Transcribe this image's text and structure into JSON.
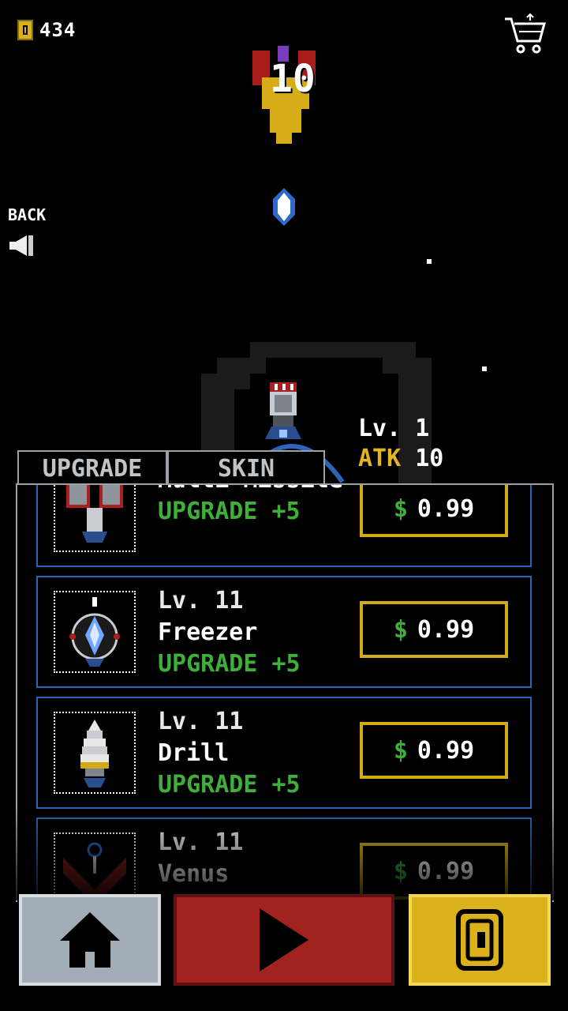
{
  "hud": {
    "coins": "434"
  },
  "back": {
    "label": "BACK"
  },
  "combat": {
    "damage": "10"
  },
  "ship_stats": {
    "level": "Lv. 1",
    "atk_label": "ATK",
    "atk_value": "10"
  },
  "tabs": [
    {
      "label": "UPGRADE"
    },
    {
      "label": "SKIN"
    }
  ],
  "items": [
    {
      "level": "",
      "name": "Multi Missile",
      "upgrade": "UPGRADE +5",
      "price": "0.99",
      "currency": "$"
    },
    {
      "level": "Lv. 11",
      "name": "Freezer",
      "upgrade": "UPGRADE +5",
      "price": "0.99",
      "currency": "$"
    },
    {
      "level": "Lv. 11",
      "name": "Drill",
      "upgrade": "UPGRADE +5",
      "price": "0.99",
      "currency": "$"
    },
    {
      "level": "Lv. 11",
      "name": "Venus",
      "upgrade": "",
      "price": "0.99",
      "currency": "$"
    }
  ],
  "icons": {
    "coin": "coin-icon",
    "cart": "cart-icon",
    "back": "speaker-back-icon",
    "home": "home-icon",
    "play": "play-icon",
    "shop_coin": "coin-icon"
  },
  "colors": {
    "gold": "#dbb21c",
    "green": "#3fae3b",
    "blue_border": "#2d64b6",
    "red": "#a2221f",
    "gray": "#a2acb6"
  }
}
